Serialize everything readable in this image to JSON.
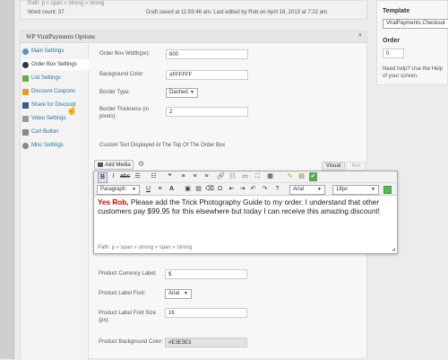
{
  "top": {
    "path": "Path: p » span » strong » strong",
    "word_count": "Word count: 37",
    "draft_saved": "Draft saved at 11:59:46 am. Last edited by Rob on April 18, 2013 at 7:22 am"
  },
  "panel": {
    "title": "WP ViralPayments Options"
  },
  "sidebar": {
    "items": [
      {
        "label": "Main Settings",
        "icon": "gear-icon"
      },
      {
        "label": "Order Box Settings",
        "icon": "circle-icon"
      },
      {
        "label": "List Settings",
        "icon": "list-icon"
      },
      {
        "label": "Discount Coupons",
        "icon": "tag-icon"
      },
      {
        "label": "Share for Discount",
        "icon": "facebook-icon"
      },
      {
        "label": "Video Settings",
        "icon": "video-icon"
      },
      {
        "label": "Cart Button",
        "icon": "cart-icon"
      },
      {
        "label": "Misc Settings",
        "icon": "gear-icon"
      }
    ]
  },
  "form": {
    "width_label": "Order Box Width(px):",
    "width_value": "600",
    "bg_label": "Background Color:",
    "bg_value": "#FFFFFF",
    "border_type_label": "Border Type:",
    "border_type_value": "Dashed",
    "border_thickness_label_1": "Border Thickness (in",
    "border_thickness_label_2": "pixels):",
    "border_thickness_value": "2",
    "custom_text_label": "Custom Text Displayed At The Top Of The Order Box"
  },
  "editor": {
    "add_media": "Add Media",
    "tab_visual": "Visual",
    "tab_text": "Text",
    "format_value": "Paragraph",
    "font_value": "Arial",
    "size_value": "18px",
    "content_highlight": "Yes Rob,",
    "content_rest": " Please add the Trick Photography Guide to my order. I understand that other customers pay $99.95 for this elsewhere but today I can receive this amazing discount!",
    "path": "Path: p » span » strong » span » strong"
  },
  "product": {
    "currency_label": "Product Currency Label:",
    "currency_value": "$",
    "font_label": "Product Label Font:",
    "font_value": "Arial",
    "font_size_label_1": "Product Label Font Size",
    "font_size_label_2": "(px):",
    "font_size_value": "16",
    "bg_label": "Product Background Color:",
    "bg_value": "#E3E3E3"
  },
  "right": {
    "template_label": "Template",
    "template_value": "ViralPayments Checkout",
    "order_label": "Order",
    "order_value": "0",
    "help_text_1": "Need help? Use the Help",
    "help_text_2": "of your screen."
  },
  "colors": {
    "accent": "#21759b",
    "highlight": "#cc0000",
    "bg_swatch": "#FFFFFF",
    "product_bg": "#E3E3E3"
  }
}
